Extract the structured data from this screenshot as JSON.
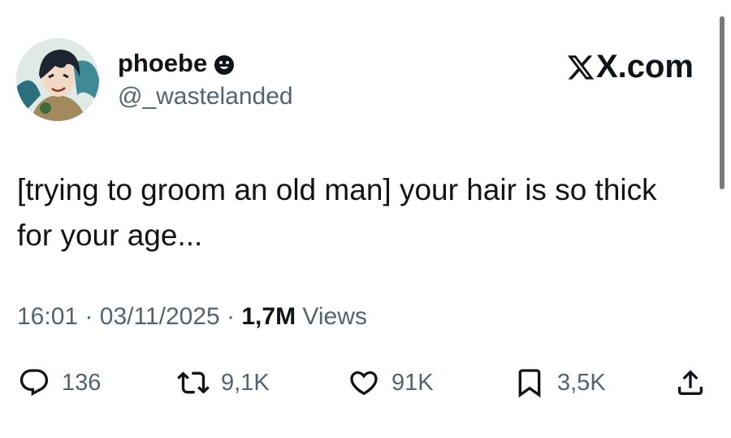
{
  "user": {
    "display_name": "phoebe",
    "handle": "@_wastelanded",
    "badge_icon": "smiley-icon"
  },
  "brand": {
    "label": "X.com"
  },
  "tweet": {
    "text_line1": "[trying to groom an old man] your hair is so thick",
    "text_line2": "for your age..."
  },
  "meta": {
    "time": "16:01",
    "separator": "·",
    "date": "03/11/2025",
    "views_count": "1,7M",
    "views_label": "Views"
  },
  "actions": {
    "replies": "136",
    "reposts": "9,1K",
    "likes": "91K",
    "bookmarks": "3,5K"
  },
  "colors": {
    "text": "#0f1419",
    "secondary": "#536471",
    "background": "#ffffff"
  }
}
